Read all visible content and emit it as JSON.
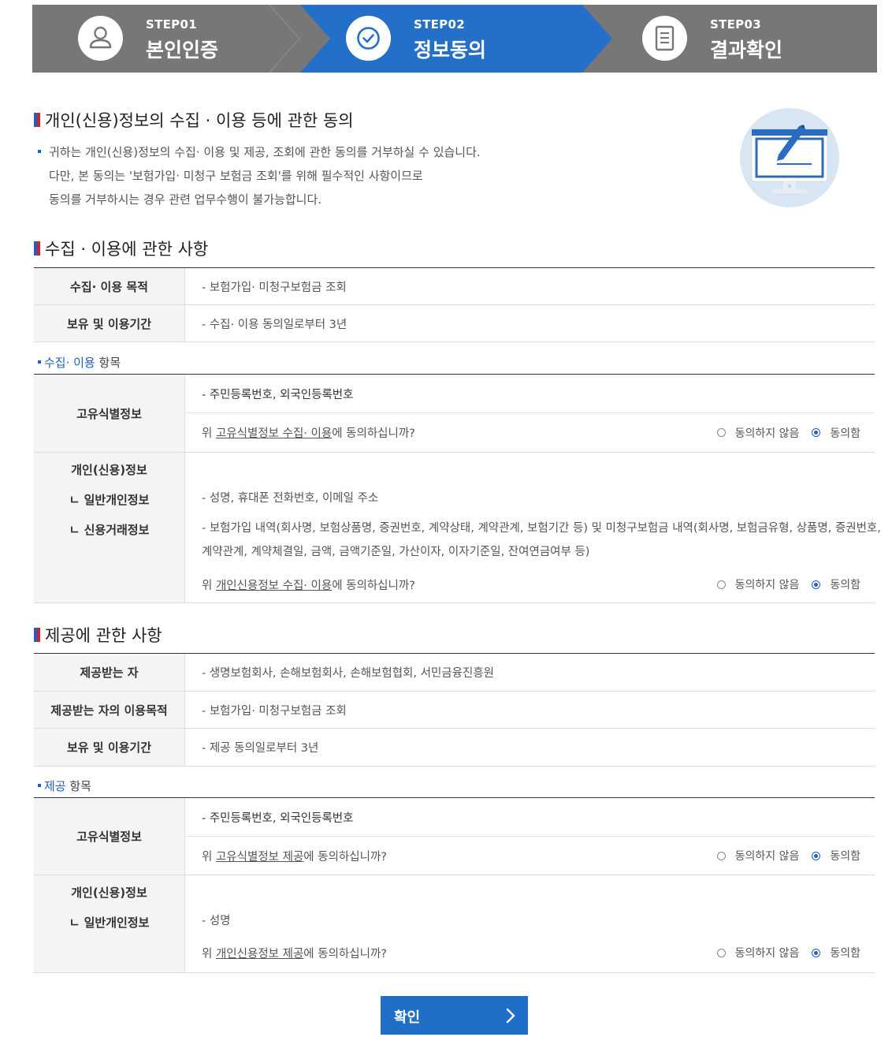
{
  "steps": [
    {
      "num": "STEP01",
      "name": "본인인증",
      "icon": "user-icon",
      "active": false
    },
    {
      "num": "STEP02",
      "name": "정보동의",
      "icon": "check-circle-icon",
      "active": true
    },
    {
      "num": "STEP03",
      "name": "결과확인",
      "icon": "document-icon",
      "active": false
    }
  ],
  "colors": {
    "step_inactive": "#777777",
    "step_active": "#2470c9",
    "accent": "#1f5fbf",
    "accent_red": "#d0232b"
  },
  "consent": {
    "title": "개인(신용)정보의 수집 · 이용 등에 관한 동의",
    "lines": [
      "귀하는 개인(신용)정보의 수집· 이용 및 제공, 조회에 관한 동의를 거부하실 수 있습니다.",
      "다만, 본 동의는 '보험가입· 미청구 보험금 조회'를 위해 필수적인 사항이므로",
      "동의를 거부하시는 경우 관련 업무수행이 불가능합니다."
    ]
  },
  "collect": {
    "title": "수집 · 이용에 관한 사항",
    "rows": [
      {
        "label": "수집· 이용 목적",
        "value": "- 보험가입· 미청구보험금 조회"
      },
      {
        "label": "보유 및 이용기간",
        "value": "- 수집· 이용 동의일로부터 3년"
      }
    ],
    "items_title_blue": "수집· 이용",
    "items_title_rest": " 항목",
    "unique": {
      "label": "고유식별정보",
      "value": "- 주민등록번호, 외국인등록번호",
      "q_pre": "위 ",
      "q_link": "고유식별정보 수집· 이용",
      "q_post": "에 동의하십니까?"
    },
    "personal": {
      "label": "개인(신용)정보",
      "sub1": "ㄴ 일반개인정보",
      "sub2": "ㄴ 신용거래정보",
      "line1": "- 성명, 휴대폰 전화번호, 이메일 주소",
      "line2": "- 보험가입 내역(회사명, 보험상품명, 증권번호, 계약상태, 계약관계, 보험기간 등) 및 미청구보험금 내역(회사명, 보험금유형, 상품명, 증권번호,",
      "line3": "계약관계, 계약체결일, 금액, 금액기준일, 가산이자, 이자기준일, 잔여연금여부 등)",
      "q_pre": "위 ",
      "q_link": "개인신용정보 수집· 이용",
      "q_post": "에 동의하십니까?"
    }
  },
  "provide": {
    "title": "제공에 관한 사항",
    "rows": [
      {
        "label": "제공받는 자",
        "value": "- 생명보험회사, 손해보험회사, 손해보험협회, 서민금융진흥원"
      },
      {
        "label": "제공받는 자의 이용목적",
        "value": "- 보험가입· 미청구보험금 조회"
      },
      {
        "label": "보유 및 이용기간",
        "value": "- 제공 동의일로부터 3년"
      }
    ],
    "items_title_blue": "제공",
    "items_title_rest": " 항목",
    "unique": {
      "label": "고유식별정보",
      "value": "- 주민등록번호, 외국인등록번호",
      "q_pre": "위 ",
      "q_link": "고유식별정보 제공",
      "q_post": "에 동의하십니까?"
    },
    "personal": {
      "label": "개인(신용)정보",
      "sub1": "ㄴ 일반개인정보",
      "line1": "- 성명",
      "q_pre": "위 ",
      "q_link": "개인신용정보 제공",
      "q_post": "에 동의하십니까?"
    }
  },
  "radio": {
    "disagree": "동의하지 않음",
    "agree": "동의함",
    "selected": "agree"
  },
  "confirm_label": "확인"
}
